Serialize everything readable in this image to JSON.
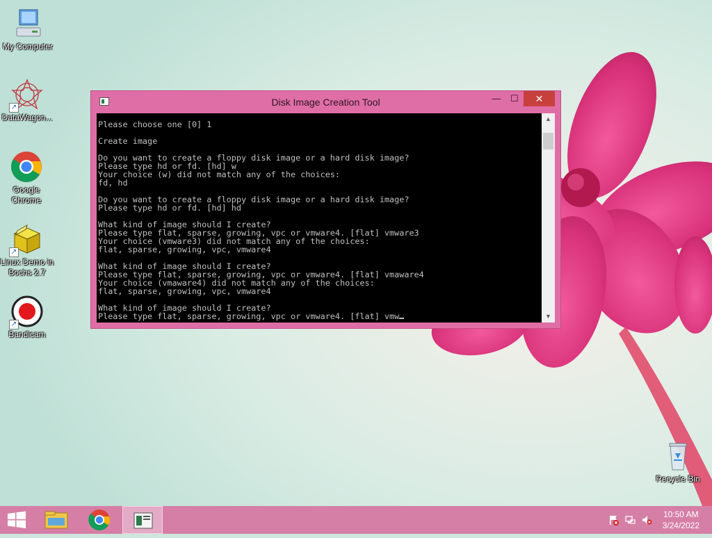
{
  "desktop": {
    "icons": [
      {
        "label": "My Computer",
        "icon": "computer-icon"
      },
      {
        "label": "DataWagon...",
        "icon": "datawagon-icon"
      },
      {
        "label": "Google Chrome",
        "icon": "chrome-icon"
      },
      {
        "label": "Linux Demo in Bochs 2.7",
        "icon": "bochs-icon"
      },
      {
        "label": "Bandicam",
        "icon": "bandicam-icon"
      },
      {
        "label": "Recycle Bin",
        "icon": "recycle-bin-icon"
      }
    ]
  },
  "window": {
    "title": "Disk Image Creation Tool",
    "minimize_label": "—",
    "maximize_label": "☐",
    "close_label": "✕",
    "console_lines": [
      "Please choose one [0] 1",
      "",
      "Create image",
      "",
      "Do you want to create a floppy disk image or a hard disk image?",
      "Please type hd or fd. [hd] w",
      "Your choice (w) did not match any of the choices:",
      "fd, hd",
      "",
      "Do you want to create a floppy disk image or a hard disk image?",
      "Please type hd or fd. [hd] hd",
      "",
      "What kind of image should I create?",
      "Please type flat, sparse, growing, vpc or vmware4. [flat] vmware3",
      "Your choice (vmware3) did not match any of the choices:",
      "flat, sparse, growing, vpc, vmware4",
      "",
      "What kind of image should I create?",
      "Please type flat, sparse, growing, vpc or vmware4. [flat] vmaware4",
      "Your choice (vmaware4) did not match any of the choices:",
      "flat, sparse, growing, vpc, vmware4",
      "",
      "What kind of image should I create?"
    ],
    "input_prompt": "Please type flat, sparse, growing, vpc or vmware4. [flat] vmw",
    "scroll_up": "▲",
    "scroll_down": "▼"
  },
  "taskbar": {
    "clock_time": "10:50 AM",
    "clock_date": "3/24/2022"
  },
  "colors": {
    "window_frame": "#e06ea6",
    "close_button": "#c7403d",
    "taskbar": "#d57fa7",
    "console_bg": "#000000",
    "console_text": "#c0c0c0"
  }
}
